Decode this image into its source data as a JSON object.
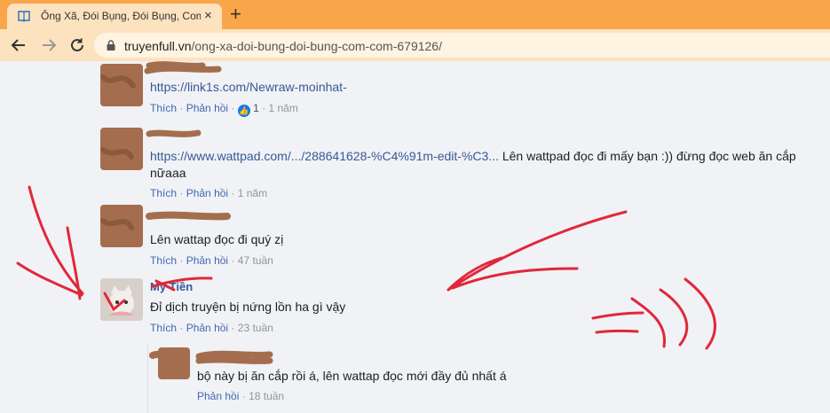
{
  "browser": {
    "tab_title": "Ông Xã, Đói Bụng, Đói Bụng, Com",
    "new_tab_symbol": "+",
    "close_symbol": "×",
    "url_host": "truyenfull.vn",
    "url_path": "/ong-xa-doi-bung-doi-bung-com-com-679126/"
  },
  "comments": [
    {
      "text_link": "https://link1s.com/Newraw-moinhat-",
      "text": "",
      "like": "Thích",
      "reply": "Phản hồi",
      "reaction_count": "1",
      "time": "1 năm"
    },
    {
      "text_link": "https://www.wattpad.com/.../288641628-%C4%91m-edit-%C3...",
      "text": " Lên wattpad đọc đi mấy bạn :)) đừng đọc web ăn cắp nữaaa",
      "like": "Thích",
      "reply": "Phản hồi",
      "time": "1 năm"
    },
    {
      "text": "Lên wattap đọc đi quý zị",
      "like": "Thích",
      "reply": "Phản hồi",
      "time": "47 tuần"
    },
    {
      "name": "Mỹ Tiền",
      "text": "Đỉ dịch truyện bị nứng lồn ha gì vậy",
      "like": "Thích",
      "reply": "Phản hồi",
      "time": "23 tuần"
    }
  ],
  "reply": {
    "text": "bộ này bị ăn cắp rồi á, lên wattap đọc mới đầy đủ nhất á",
    "reply": "Phản hồi",
    "time": "18 tuần"
  },
  "separator": "·",
  "colors": {
    "tabbar": "#f9a64a",
    "toolbar": "#fde2bf",
    "link": "#385898",
    "scribble": "#e0283a"
  }
}
